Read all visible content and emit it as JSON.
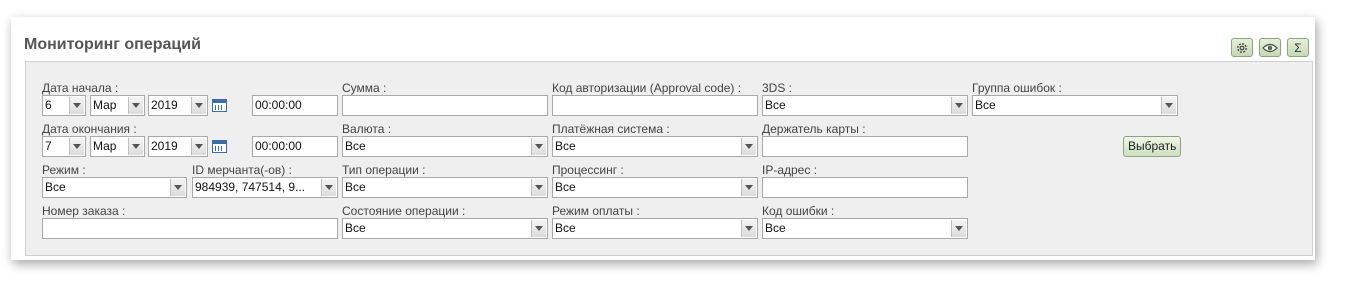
{
  "title": "Мониторинг операций",
  "toolbar": {
    "settings_icon": "gear-icon",
    "view_icon": "eye-icon",
    "sum_label": "Σ"
  },
  "fields": {
    "start_date_label": "Дата начала :",
    "start_day": "6",
    "start_month": "Мар",
    "start_year": "2019",
    "start_time": "00:00:00",
    "end_date_label": "Дата окончания :",
    "end_day": "7",
    "end_month": "Мар",
    "end_year": "2019",
    "end_time": "00:00:00",
    "mode_label": "Режим :",
    "mode_value": "Все",
    "merchant_label": "ID мерчанта(-ов) :",
    "merchant_value": "984939, 747514, 9...",
    "order_label": "Номер заказа :",
    "order_value": "",
    "amount_label": "Сумма :",
    "amount_value": "",
    "currency_label": "Валюта :",
    "currency_value": "Все",
    "op_type_label": "Тип операции :",
    "op_type_value": "Все",
    "op_state_label": "Состояние операции :",
    "op_state_value": "Все",
    "auth_code_label": "Код авторизации (Approval code) :",
    "auth_code_value": "",
    "payment_system_label": "Платёжная система :",
    "payment_system_value": "Все",
    "processing_label": "Процессинг :",
    "processing_value": "Все",
    "payment_mode_label": "Режим оплаты :",
    "payment_mode_value": "Все",
    "threeds_label": "3DS :",
    "threeds_value": "Все",
    "cardholder_label": "Держатель карты :",
    "cardholder_value": "",
    "ip_label": "IP-адрес :",
    "ip_value": "",
    "error_code_label": "Код ошибки :",
    "error_code_value": "Все",
    "error_group_label": "Группа ошибок :",
    "error_group_value": "Все"
  },
  "submit_label": "Выбрать"
}
